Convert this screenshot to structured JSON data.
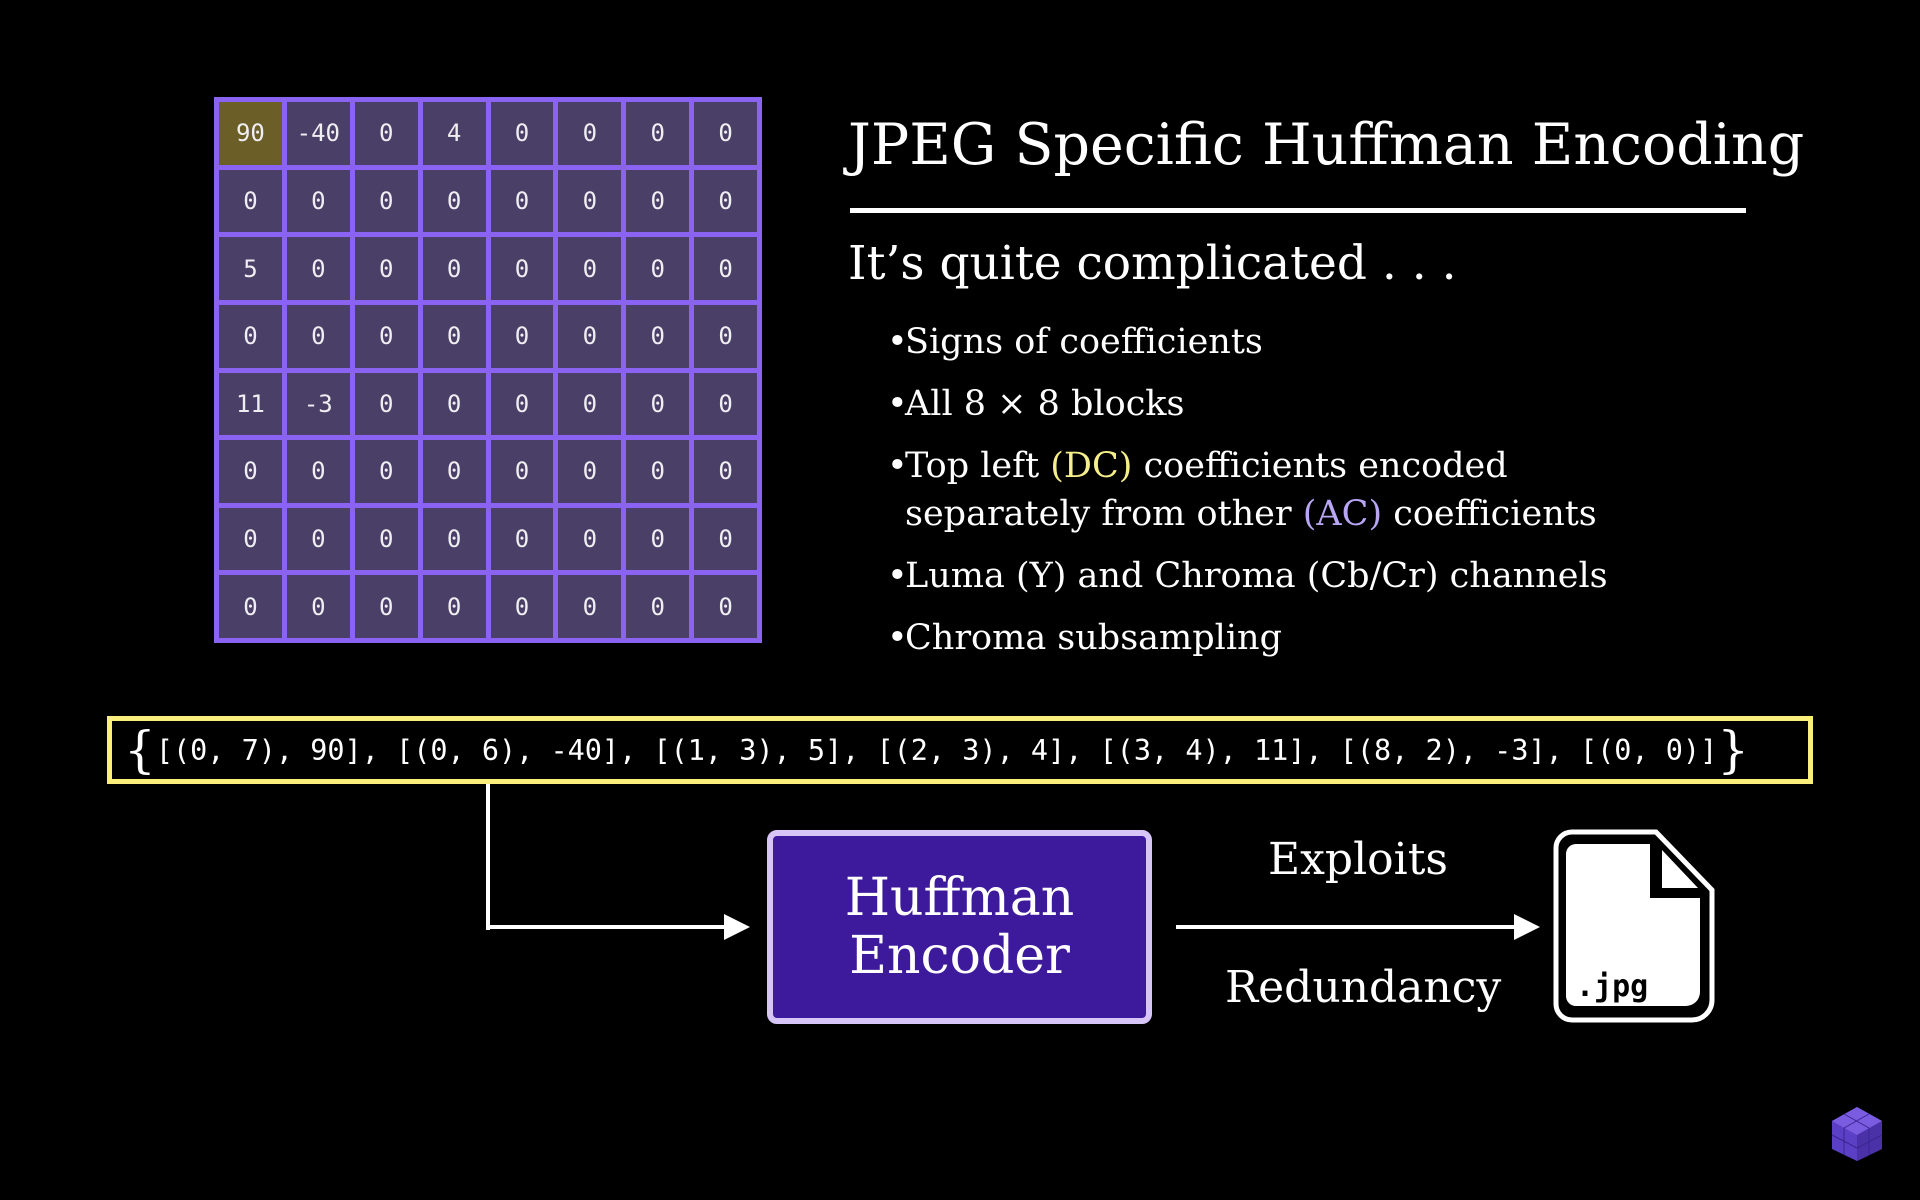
{
  "matrix": [
    [
      "90",
      "-40",
      "0",
      "4",
      "0",
      "0",
      "0",
      "0"
    ],
    [
      "0",
      "0",
      "0",
      "0",
      "0",
      "0",
      "0",
      "0"
    ],
    [
      "5",
      "0",
      "0",
      "0",
      "0",
      "0",
      "0",
      "0"
    ],
    [
      "0",
      "0",
      "0",
      "0",
      "0",
      "0",
      "0",
      "0"
    ],
    [
      "11",
      "-3",
      "0",
      "0",
      "0",
      "0",
      "0",
      "0"
    ],
    [
      "0",
      "0",
      "0",
      "0",
      "0",
      "0",
      "0",
      "0"
    ],
    [
      "0",
      "0",
      "0",
      "0",
      "0",
      "0",
      "0",
      "0"
    ],
    [
      "0",
      "0",
      "0",
      "0",
      "0",
      "0",
      "0",
      "0"
    ]
  ],
  "title": "JPEG Specific Huffman Encoding",
  "subtitle": "It’s quite complicated . . .",
  "bullets": {
    "b1": "Signs of coefficients",
    "b2": "All 8 × 8 blocks",
    "b3_pre": "Top left ",
    "b3_dc": "(DC)",
    "b3_mid": " coefficients encoded",
    "b3_line2_pre": "separately from other ",
    "b3_ac": "(AC)",
    "b3_line2_post": " coefficients",
    "b4": "Luma (Y) and Chroma (Cb/Cr) channels",
    "b5": "Chroma subsampling"
  },
  "rle": {
    "open": "{",
    "text": "[(0, 7), 90], [(0, 6), -40], [(1, 3), 5], [(2, 3), 4], [(3, 4), 11], [(8, 2), -3], [(0, 0)]",
    "close": "}"
  },
  "encoder": {
    "line1": "Huffman",
    "line2": "Encoder"
  },
  "arrow_top_label": "Exploits",
  "arrow_bottom_label": "Redundancy",
  "file_ext": ".jpg",
  "colors": {
    "dc": "#f5ee8a",
    "ac": "#b8a6f5",
    "grid": "#8a63f2",
    "rle_border": "#fbef7c",
    "encoder_fill": "#3d1a9c"
  }
}
